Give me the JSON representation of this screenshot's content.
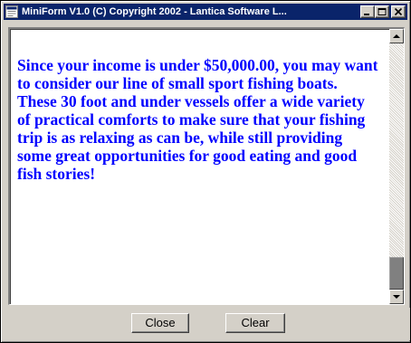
{
  "window": {
    "title": "MiniForm V1.0 (C) Copyright 2002 - Lantica Software L...",
    "title_icon": "app-icon",
    "controls": {
      "minimize_icon": "minimize-icon",
      "maximize_icon": "maximize-icon",
      "close_icon": "close-icon"
    }
  },
  "content": {
    "message": "Since your income is under $50,000.00, you may want to consider our line of small sport fishing boats. These 30 foot and under vessels offer a wide variety of practical comforts to make sure that your fishing trip is as relaxing as can be, while still providing some great opportunities for good eating and good fish stories!",
    "text_color": "#0000ff"
  },
  "footer": {
    "close_label": "Close",
    "clear_label": "Clear"
  },
  "colors": {
    "titlebar": "#0a246a",
    "face": "#d4d0c8"
  }
}
